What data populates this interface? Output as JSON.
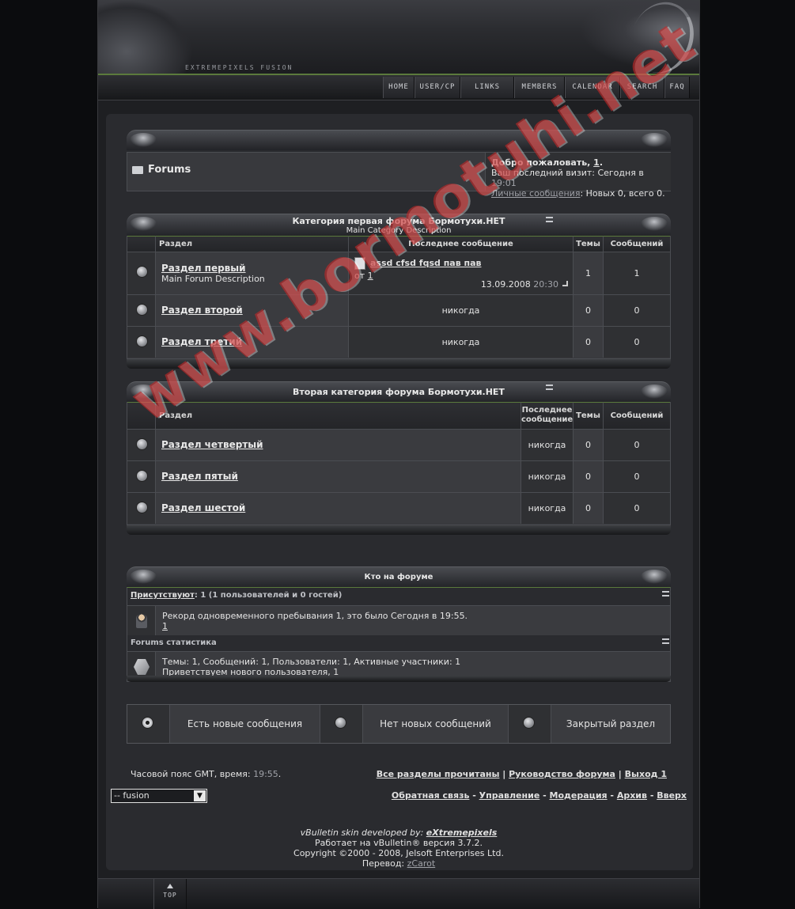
{
  "header": {
    "logo_text": "EXTREMEPIXELS FUSION",
    "nav": [
      "HOME",
      "USER/CP",
      "LINKS",
      "MEMBERS",
      "CALENDAR",
      "SEARCH",
      "FAQ"
    ]
  },
  "breadcrumb": {
    "title": "Forums",
    "welcome_prefix": "Добро пожаловать, ",
    "welcome_user": "1",
    "welcome_suffix": ".",
    "last_visit_label": "Ваш последний визит: Сегодня в ",
    "last_visit_time": "19:01",
    "pm_link": "Личные сообщения",
    "pm_stats": ": Новых 0, всего 0."
  },
  "category1": {
    "title": "Категория первая форума Бормотухи.НЕТ",
    "description": "Main Category Description",
    "columns": {
      "forum": "Раздел",
      "last_post": "Последнее сообщение",
      "threads": "Темы",
      "posts": "Сообщений"
    },
    "forums": [
      {
        "name": "Раздел первый",
        "description": "Main Forum Description",
        "last_thread": "assd cfsd fqsd пав пав",
        "by_label": "от",
        "by_user": "1",
        "date": "13.09.2008",
        "time": "20:30",
        "threads": "1",
        "posts": "1"
      },
      {
        "name": "Раздел второй",
        "last_post": "никогда",
        "threads": "0",
        "posts": "0"
      },
      {
        "name": "Раздел третий",
        "last_post": "никогда",
        "threads": "0",
        "posts": "0"
      }
    ]
  },
  "category2": {
    "title": "Вторая категория форума Бормотухи.НЕТ",
    "columns": {
      "forum": "Раздел",
      "last_post_l1": "Последнее",
      "last_post_l2": "сообщение",
      "threads": "Темы",
      "posts": "Сообщений"
    },
    "forums": [
      {
        "name": "Раздел четвертый",
        "last_post": "никогда",
        "threads": "0",
        "posts": "0"
      },
      {
        "name": "Раздел пятый",
        "last_post": "никогда",
        "threads": "0",
        "posts": "0"
      },
      {
        "name": "Раздел шестой",
        "last_post": "никогда",
        "threads": "0",
        "posts": "0"
      }
    ]
  },
  "whos_online": {
    "title": "Кто на форуме",
    "present_link": "Присутствуют",
    "present_text": ": 1 (1 пользователей и 0 гостей)",
    "record_text": "Рекорд одновременного пребывания 1, это было Сегодня в 19:55.",
    "record_user": "1",
    "stats_title": "Forums статистика",
    "stats_text": "Темы: 1, Сообщений: 1, Пользователи: 1, Активные участники: 1",
    "welcome_text": "Приветствуем нового пользователя, ",
    "welcome_user": "1"
  },
  "legend": {
    "new_posts": "Есть новые сообщения",
    "no_new_posts": "Нет новых сообщений",
    "closed": "Закрытый раздел"
  },
  "footer": {
    "timezone_label": "Часовой пояс GMT, время: ",
    "timezone_time": "19:55",
    "timezone_suffix": ".",
    "links_top": [
      "Все разделы прочитаны",
      "Руководство форума",
      "Выход 1"
    ],
    "links_bottom": [
      "Обратная связь",
      "Управление",
      "Модерация",
      "Архив",
      "Вверх"
    ],
    "style_select": "-- fusion",
    "skin_label": "vBulletin skin developed by: ",
    "skin_author": "eXtremepixels",
    "powered": "Работает на vBulletin® версия 3.7.2.",
    "copyright": "Copyright ©2000 - 2008, Jelsoft Enterprises Ltd.",
    "translation_label": "Перевод: ",
    "translator": "zCarot",
    "top_label": "TOP"
  },
  "watermark": "www.bormotuhi.net"
}
